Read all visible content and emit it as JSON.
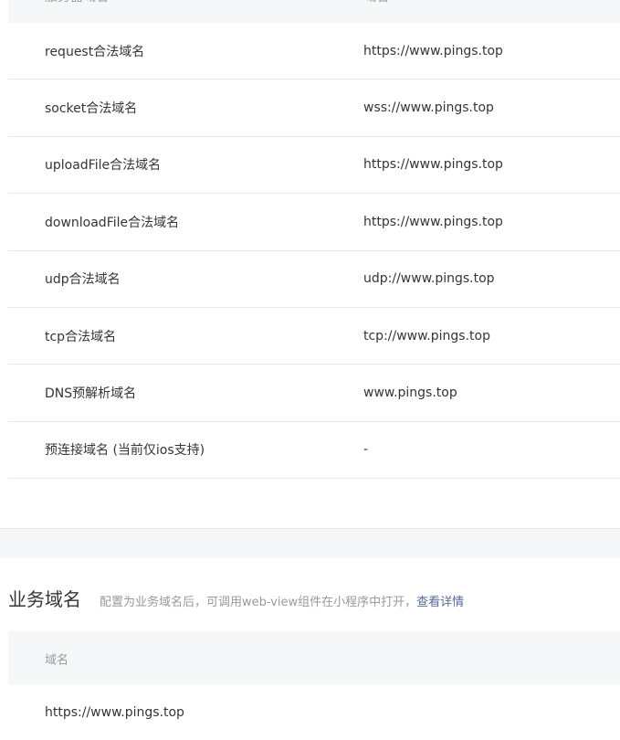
{
  "server_domains": {
    "header": {
      "col_type": "服务器域名",
      "col_domain": "域名"
    },
    "rows": [
      {
        "name": "request合法域名",
        "value": "https://www.pings.top"
      },
      {
        "name": "socket合法域名",
        "value": "wss://www.pings.top"
      },
      {
        "name": "uploadFile合法域名",
        "value": "https://www.pings.top"
      },
      {
        "name": "downloadFile合法域名",
        "value": "https://www.pings.top"
      },
      {
        "name": "udp合法域名",
        "value": "udp://www.pings.top"
      },
      {
        "name": "tcp合法域名",
        "value": "tcp://www.pings.top"
      },
      {
        "name": "DNS预解析域名",
        "value": "www.pings.top"
      },
      {
        "name": "预连接域名 (当前仅ios支持)",
        "value": "-"
      }
    ]
  },
  "business_domains": {
    "title": "业务域名",
    "description": "配置为业务域名后，可调用web-view组件在小程序中打开，",
    "link_label": "查看详情",
    "table_header": "域名",
    "rows": [
      {
        "name": "https://www.pings.top"
      }
    ]
  }
}
